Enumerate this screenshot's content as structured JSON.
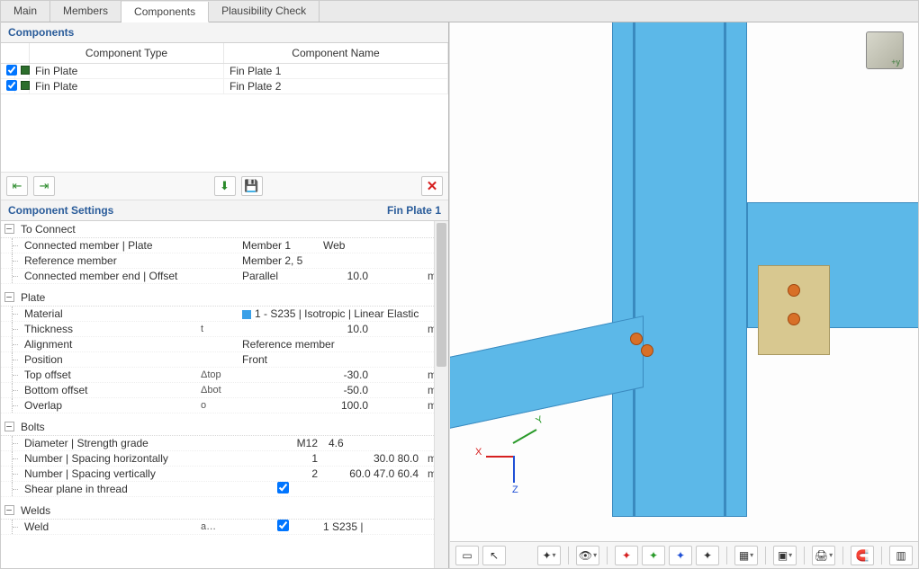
{
  "tabs": {
    "main": "Main",
    "members": "Members",
    "components": "Components",
    "plausibility": "Plausibility Check"
  },
  "components_panel": {
    "title": "Components",
    "col_type": "Component Type",
    "col_name": "Component Name",
    "rows": [
      {
        "type": "Fin Plate",
        "name": "Fin Plate 1"
      },
      {
        "type": "Fin Plate",
        "name": "Fin Plate 2"
      }
    ]
  },
  "settings_panel": {
    "title": "Component Settings",
    "current": "Fin Plate 1",
    "sections": {
      "to_connect": {
        "title": "To Connect",
        "connected_member_plate": {
          "label": "Connected member | Plate",
          "v1": "Member 1",
          "v2": "Web"
        },
        "reference_member": {
          "label": "Reference member",
          "v1": "Member 2, 5"
        },
        "connected_end_offset": {
          "label": "Connected member end | Offset",
          "v1": "Parallel",
          "v2": "10.0",
          "unit": "mm"
        }
      },
      "plate": {
        "title": "Plate",
        "material": {
          "label": "Material",
          "v1": "1 - S235 | Isotropic | Linear Elastic"
        },
        "thickness": {
          "label": "Thickness",
          "sym": "t",
          "v2": "10.0",
          "unit": "mm"
        },
        "alignment": {
          "label": "Alignment",
          "v1": "Reference member"
        },
        "position": {
          "label": "Position",
          "v1": "Front"
        },
        "top_offset": {
          "label": "Top offset",
          "sym": "Δtop",
          "v2": "-30.0",
          "unit": "mm"
        },
        "bottom_offset": {
          "label": "Bottom offset",
          "sym": "Δbot",
          "v2": "-50.0",
          "unit": "mm"
        },
        "overlap": {
          "label": "Overlap",
          "sym": "o",
          "v2": "100.0",
          "unit": "mm"
        }
      },
      "bolts": {
        "title": "Bolts",
        "diameter_grade": {
          "label": "Diameter | Strength grade",
          "v1": "M12",
          "v2": "4.6"
        },
        "num_spacing_h": {
          "label": "Number | Spacing horizontally",
          "v1": "1",
          "v2": "30.0 80.0",
          "unit": "mm"
        },
        "num_spacing_v": {
          "label": "Number | Spacing vertically",
          "v1": "2",
          "v2": "60.0 47.0 60.4",
          "unit": "mm"
        },
        "shear_plane": {
          "label": "Shear plane in thread"
        }
      },
      "welds": {
        "title": "Welds",
        "weld": {
          "label": "Weld",
          "sym": "a…",
          "v2": "1   S235 |"
        }
      }
    }
  },
  "toolbar": {
    "arrow_in": "⇤",
    "arrow_out": "⇥",
    "import": "⬇",
    "save": "💾",
    "delete": "✕"
  },
  "viewport_tools": {
    "select": "▭",
    "pick": "↖",
    "view": "👁",
    "axes": "✦",
    "print": "🖨",
    "magnet": "🧲",
    "layout": "▥"
  }
}
